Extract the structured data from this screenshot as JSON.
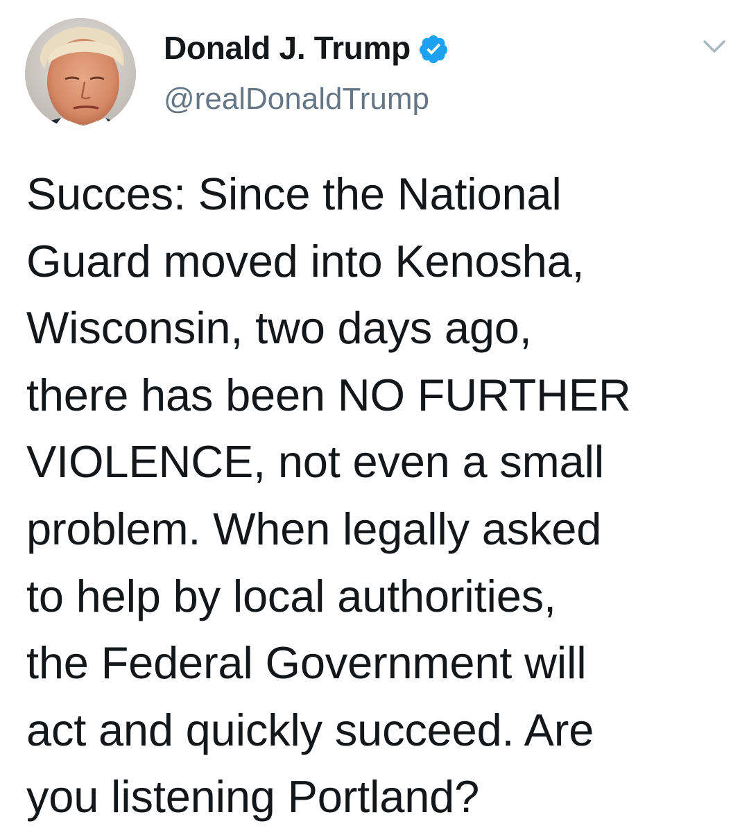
{
  "author": {
    "display_name": "Donald J. Trump",
    "handle": "@realDonaldTrump",
    "verified": true,
    "avatar_icon": "profile-photo"
  },
  "menu": {
    "icon": "chevron-down-icon"
  },
  "tweet": {
    "lines": [
      "Succes: Since the National",
      "Guard moved into Kenosha,",
      "Wisconsin, two days ago,",
      "there has been NO FURTHER",
      "VIOLENCE, not even a small",
      "problem. When legally asked",
      "to help by local authorities,",
      "the Federal Government will",
      "act and quickly succeed. Are",
      "you listening Portland?"
    ]
  },
  "colors": {
    "text": "#14171a",
    "secondary": "#657786",
    "verified_blue": "#1da1f2",
    "caret": "#aab8c2",
    "background": "#ffffff"
  }
}
